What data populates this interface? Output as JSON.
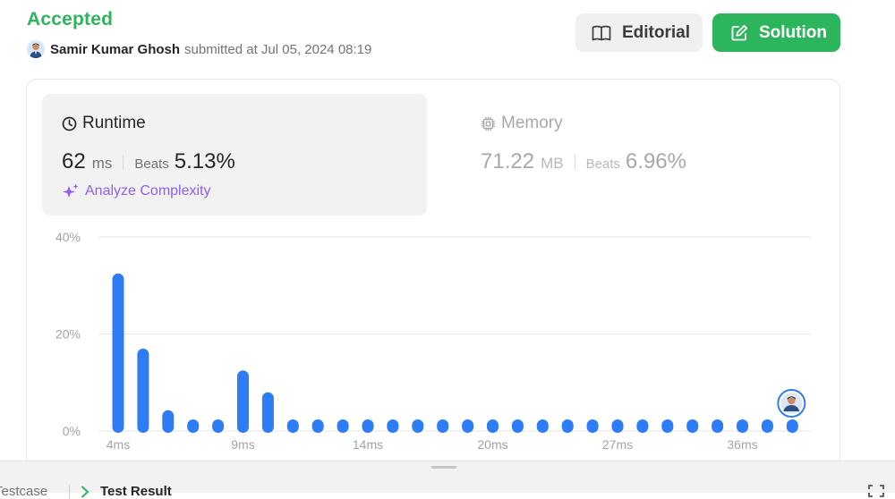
{
  "submission": {
    "status": "Accepted",
    "username": "Samir Kumar Ghosh",
    "submitted_text": "submitted at Jul 05, 2024 08:19"
  },
  "actions": {
    "editorial_label": "Editorial",
    "solution_label": "Solution"
  },
  "runtime": {
    "title": "Runtime",
    "value": "62",
    "unit": "ms",
    "beats_label": "Beats",
    "beats_value": "5.13%",
    "analyze_label": "Analyze Complexity"
  },
  "memory": {
    "title": "Memory",
    "value": "71.22",
    "unit": "MB",
    "beats_label": "Beats",
    "beats_value": "6.96%"
  },
  "bottom_tabs": {
    "testcase_label": "Testcase",
    "result_label": "Test Result"
  },
  "colors": {
    "accepted": "#2db55d",
    "bar": "#2f7df6",
    "analyze": "#8c5ff0"
  },
  "chart_data": {
    "type": "bar",
    "ylim": [
      0,
      40
    ],
    "y_ticks": [
      "0%",
      "20%",
      "40%"
    ],
    "x_tick_labels": [
      "4ms",
      "9ms",
      "14ms",
      "20ms",
      "27ms",
      "36ms"
    ],
    "values": [
      32.5,
      17,
      4.3,
      2,
      2.4,
      12.5,
      8,
      1.7,
      1,
      1,
      1,
      1,
      1,
      1,
      1,
      1,
      1,
      1,
      1,
      1,
      1,
      1,
      1,
      1,
      1,
      1,
      1,
      1
    ],
    "highlight_index": 27,
    "grid": true
  }
}
